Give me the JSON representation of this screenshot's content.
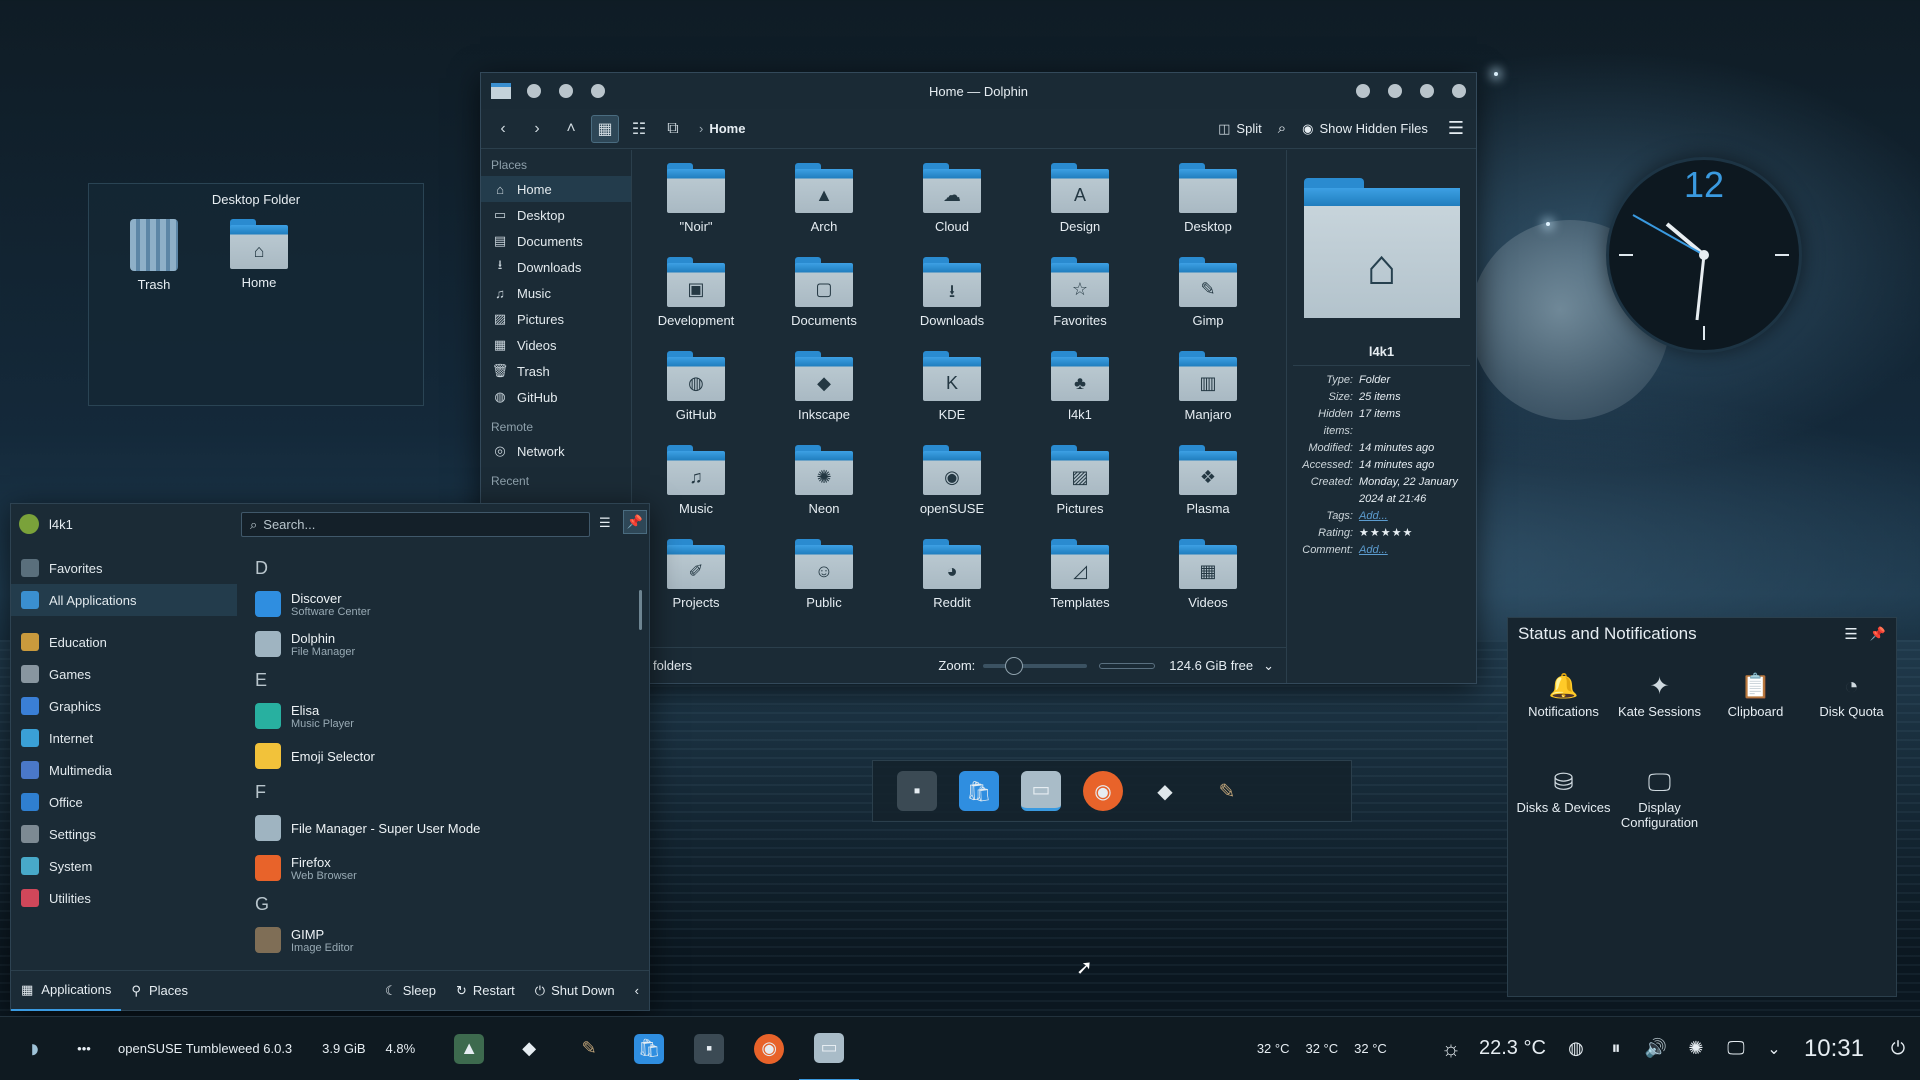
{
  "desktop_folder": {
    "title": "Desktop Folder",
    "icons": [
      {
        "label": "Trash"
      },
      {
        "label": "Home"
      }
    ]
  },
  "dolphin": {
    "title": "Home — Dolphin",
    "breadcrumb": "Home",
    "split_label": "Split",
    "hidden_label": "Show Hidden Files",
    "places_header": "Places",
    "places": [
      {
        "label": "Home",
        "icon": "⌂"
      },
      {
        "label": "Desktop",
        "icon": "▭"
      },
      {
        "label": "Documents",
        "icon": "▤"
      },
      {
        "label": "Downloads",
        "icon": "⭳"
      },
      {
        "label": "Music",
        "icon": "♫"
      },
      {
        "label": "Pictures",
        "icon": "▨"
      },
      {
        "label": "Videos",
        "icon": "▦"
      },
      {
        "label": "Trash",
        "icon": "🗑"
      },
      {
        "label": "GitHub",
        "icon": "◍"
      }
    ],
    "remote_header": "Remote",
    "remote": [
      {
        "label": "Network",
        "icon": "◎"
      }
    ],
    "recent_header": "Recent",
    "folders": [
      {
        "label": "\"Noir\"",
        "glyph": ""
      },
      {
        "label": "Arch",
        "glyph": "▲"
      },
      {
        "label": "Cloud",
        "glyph": "☁"
      },
      {
        "label": "Design",
        "glyph": "A"
      },
      {
        "label": "Desktop",
        "glyph": ""
      },
      {
        "label": "Development",
        "glyph": "▣"
      },
      {
        "label": "Documents",
        "glyph": "▢"
      },
      {
        "label": "Downloads",
        "glyph": "⭳"
      },
      {
        "label": "Favorites",
        "glyph": "☆"
      },
      {
        "label": "Gimp",
        "glyph": "✎"
      },
      {
        "label": "GitHub",
        "glyph": "◍"
      },
      {
        "label": "Inkscape",
        "glyph": "◆"
      },
      {
        "label": "KDE",
        "glyph": "K"
      },
      {
        "label": "l4k1",
        "glyph": "♣"
      },
      {
        "label": "Manjaro",
        "glyph": "▥"
      },
      {
        "label": "Music",
        "glyph": "♫"
      },
      {
        "label": "Neon",
        "glyph": "✺"
      },
      {
        "label": "openSUSE",
        "glyph": "◉"
      },
      {
        "label": "Pictures",
        "glyph": "▨"
      },
      {
        "label": "Plasma",
        "glyph": "❖"
      },
      {
        "label": "Projects",
        "glyph": "✐"
      },
      {
        "label": "Public",
        "glyph": "☺"
      },
      {
        "label": "Reddit",
        "glyph": "◕"
      },
      {
        "label": "Templates",
        "glyph": "◿"
      },
      {
        "label": "Videos",
        "glyph": "▦"
      }
    ],
    "status_text": "folders",
    "zoom_label": "Zoom:",
    "free_space": "124.6 GiB free",
    "info": {
      "name": "l4k1",
      "rows": [
        {
          "k": "Type:",
          "v": "Folder"
        },
        {
          "k": "Size:",
          "v": "25 items"
        },
        {
          "k": "Hidden items:",
          "v": "17 items"
        },
        {
          "k": "Modified:",
          "v": "14 minutes ago"
        },
        {
          "k": "Accessed:",
          "v": "14 minutes ago"
        },
        {
          "k": "Created:",
          "v": "Monday, 22 January 2024 at 21:46"
        }
      ],
      "tags_k": "Tags:",
      "tags_v": "Add...",
      "rating_k": "Rating:",
      "rating_v": "★★★★★",
      "comment_k": "Comment:",
      "comment_v": "Add..."
    }
  },
  "clock": {
    "twelve": "12"
  },
  "launcher": {
    "user": "l4k1",
    "search_placeholder": "Search...",
    "categories": [
      {
        "label": "Favorites",
        "color": "#5a6f7c"
      },
      {
        "label": "All Applications",
        "color": "#3a8fd0"
      },
      {
        "label": "Education",
        "color": "#c99a3d"
      },
      {
        "label": "Games",
        "color": "#8896a0"
      },
      {
        "label": "Graphics",
        "color": "#3a7fd6"
      },
      {
        "label": "Internet",
        "color": "#3aa0d6"
      },
      {
        "label": "Multimedia",
        "color": "#4a78c8"
      },
      {
        "label": "Office",
        "color": "#2f7fd0"
      },
      {
        "label": "Settings",
        "color": "#7d8a93"
      },
      {
        "label": "System",
        "color": "#48a9c9"
      },
      {
        "label": "Utilities",
        "color": "#d0475a"
      }
    ],
    "apps": [
      {
        "type": "letter",
        "text": "D"
      },
      {
        "type": "app",
        "name": "Discover",
        "sub": "Software Center",
        "color": "#2f8ee0"
      },
      {
        "type": "app",
        "name": "Dolphin",
        "sub": "File Manager",
        "color": "#9fb4c1"
      },
      {
        "type": "letter",
        "text": "E"
      },
      {
        "type": "app",
        "name": "Elisa",
        "sub": "Music Player",
        "color": "#28b0a0"
      },
      {
        "type": "app",
        "name": "Emoji Selector",
        "sub": "",
        "color": "#f2c23a"
      },
      {
        "type": "letter",
        "text": "F"
      },
      {
        "type": "app",
        "name": "File Manager - Super User Mode",
        "sub": "",
        "color": "#9fb4c1"
      },
      {
        "type": "app",
        "name": "Firefox",
        "sub": "Web Browser",
        "color": "#e8632a"
      },
      {
        "type": "letter",
        "text": "G"
      },
      {
        "type": "app",
        "name": "GIMP",
        "sub": "Image Editor",
        "color": "#7f6e56"
      }
    ],
    "footer": {
      "applications": "Applications",
      "places": "Places",
      "sleep": "Sleep",
      "restart": "Restart",
      "shutdown": "Shut Down"
    }
  },
  "status_panel": {
    "title": "Status and Notifications",
    "items": [
      {
        "label": "Notifications",
        "icon": "🔔"
      },
      {
        "label": "Kate Sessions",
        "icon": "✦"
      },
      {
        "label": "Clipboard",
        "icon": "📋"
      },
      {
        "label": "Disk Quota",
        "icon": "◔"
      },
      {
        "label": "Disks & Devices",
        "icon": "⛁"
      },
      {
        "label": "Display Configuration",
        "icon": "🖵"
      }
    ]
  },
  "taskbar": {
    "distro": "openSUSE Tumbleweed 6.0.3",
    "mem": "3.9 GiB",
    "cpu": "4.8%",
    "temps": [
      "32 °C",
      "32 °C",
      "32 °C"
    ],
    "weather": "22.3 °C",
    "time": "10:31"
  }
}
